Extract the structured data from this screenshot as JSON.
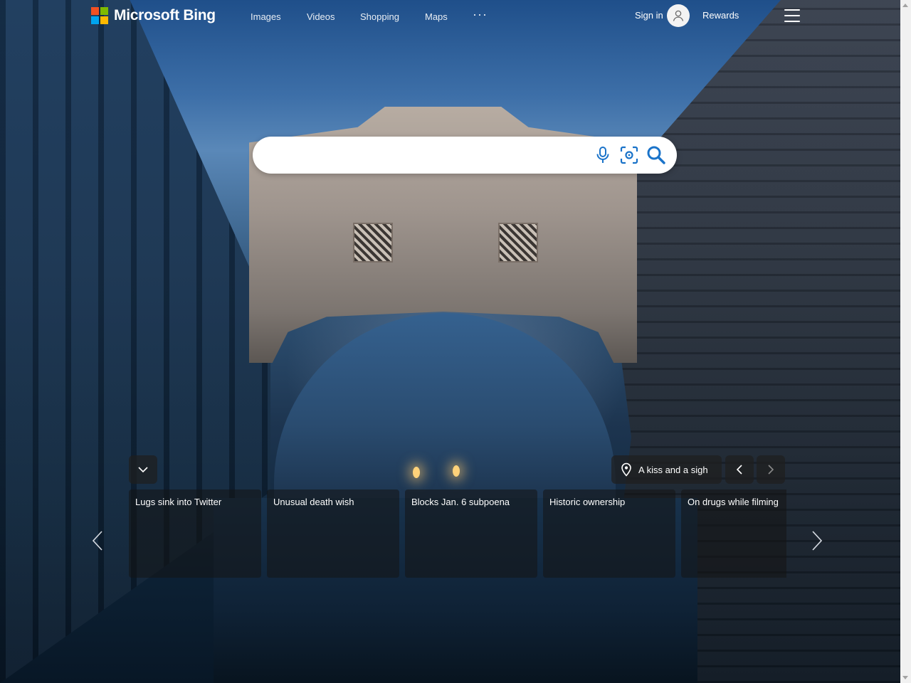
{
  "header": {
    "brand": "Microsoft Bing",
    "nav": [
      {
        "label": "Images"
      },
      {
        "label": "Videos"
      },
      {
        "label": "Shopping"
      },
      {
        "label": "Maps"
      }
    ],
    "more_label": "···",
    "signin_label": "Sign in",
    "rewards_label": "Rewards",
    "icons": {
      "more": "more-icon",
      "avatar": "user-avatar-icon",
      "menu": "hamburger-menu-icon"
    }
  },
  "search": {
    "value": "",
    "placeholder": "",
    "icons": [
      "microphone-icon",
      "visual-search-icon",
      "search-icon"
    ]
  },
  "background": {
    "location_label": "A kiss and a sigh"
  },
  "news": {
    "cards": [
      {
        "title": "Lugs sink into Twitter"
      },
      {
        "title": "Unusual death wish"
      },
      {
        "title": "Blocks Jan. 6 subpoena"
      },
      {
        "title": "Historic ownership"
      },
      {
        "title": "On drugs while filming"
      }
    ]
  },
  "colors": {
    "ms_red": "#f25022",
    "ms_green": "#7fba00",
    "ms_blue": "#00a4ef",
    "ms_yellow": "#ffb900",
    "search_icon_blue": "#1a73c9"
  }
}
